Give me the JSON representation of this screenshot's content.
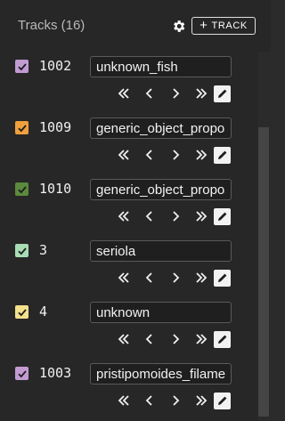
{
  "header": {
    "title": "Tracks (16)",
    "settings_icon": "gear-icon",
    "add_track_label": "TRACK",
    "add_track_icon": "plus-icon"
  },
  "controls": {
    "first_icon": "double-chevron-left-icon",
    "prev_icon": "chevron-left-icon",
    "next_icon": "chevron-right-icon",
    "last_icon": "double-chevron-right-icon",
    "edit_icon": "pencil-edit-icon"
  },
  "tracks": [
    {
      "id": "1002",
      "name": "unknown_fish",
      "checked": true,
      "color": "#c39bd3"
    },
    {
      "id": "1009",
      "name": "generic_object_proposal",
      "checked": true,
      "color": "#f0a03c"
    },
    {
      "id": "1010",
      "name": "generic_object_proposal",
      "checked": true,
      "color": "#5a8a3c"
    },
    {
      "id": "3",
      "name": "seriola",
      "checked": true,
      "color": "#a8dcb4"
    },
    {
      "id": "4",
      "name": "unknown",
      "checked": true,
      "color": "#f5e08c"
    },
    {
      "id": "1003",
      "name": "pristipomoides_filamentosus",
      "checked": true,
      "color": "#c39bd3"
    }
  ]
}
